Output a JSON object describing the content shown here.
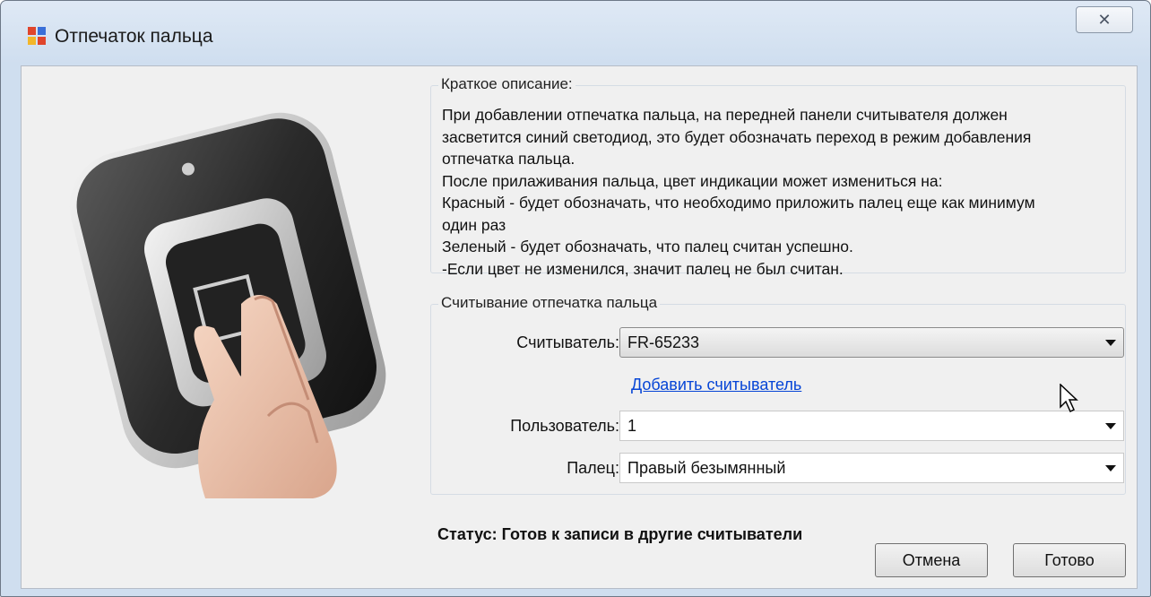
{
  "window": {
    "title": "Отпечаток пальца",
    "close_glyph": "✕"
  },
  "description": {
    "legend": "Краткое описание:",
    "text": "При добавлении отпечатка пальца, на передней панели считывателя должен\nзасветится синий светодиод, это будет обозначать переход в режим добавления\nотпечатка пальца.\nПосле прилаживания пальца, цвет индикации может измениться на:\nКрасный - будет обозначать, что необходимо приложить палец еще как минимум\nодин раз\nЗеленый - будет обозначать, что палец считан успешно.\n-Если цвет не изменился, значит палец не был считан."
  },
  "reading": {
    "legend": "Считывание отпечатка пальца",
    "reader_label": "Считыватель:",
    "reader_value": "FR-65233",
    "add_reader_link": "Добавить считыватель",
    "user_label": "Пользователь:",
    "user_value": "1",
    "finger_label": "Палец:",
    "finger_value": "Правый безымянный"
  },
  "status": {
    "text": "Статус: Готов к записи в другие считыватели"
  },
  "buttons": {
    "cancel": "Отмена",
    "done": "Готово"
  },
  "icons": {
    "app": "fingerprint-app-icon",
    "close": "close-icon",
    "cursor": "mouse-pointer-icon"
  }
}
